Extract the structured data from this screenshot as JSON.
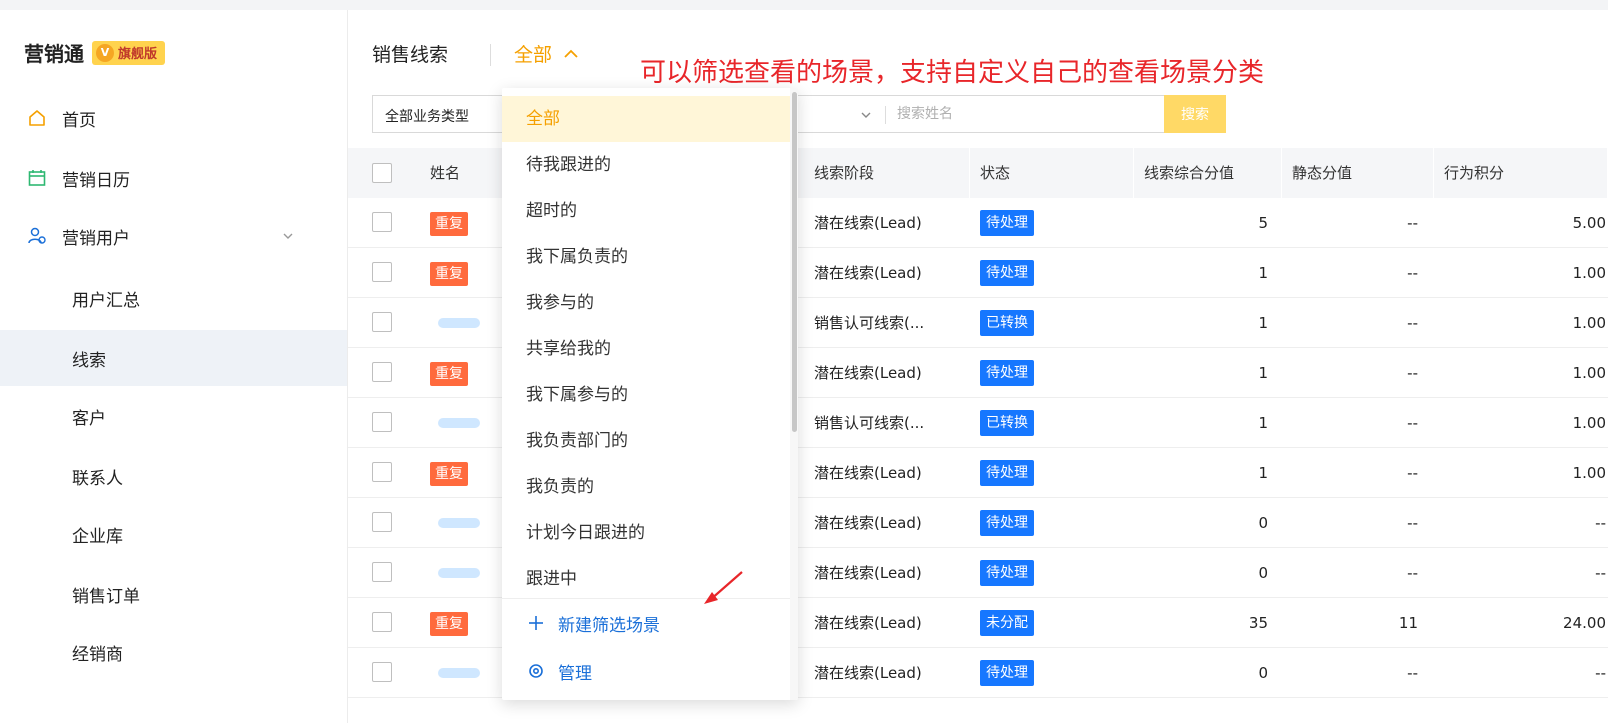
{
  "sidebar": {
    "brand": "营销通",
    "badge": "旗舰版",
    "badge_icon": "V",
    "items": [
      {
        "label": "首页",
        "icon": "home-icon"
      },
      {
        "label": "营销日历",
        "icon": "calendar-icon"
      },
      {
        "label": "营销用户",
        "icon": "user-group-icon"
      },
      {
        "label": "用户汇总"
      },
      {
        "label": "线索"
      },
      {
        "label": "客户"
      },
      {
        "label": "联系人"
      },
      {
        "label": "企业库"
      },
      {
        "label": "销售订单"
      },
      {
        "label": "经销商"
      }
    ]
  },
  "header": {
    "title": "销售线索",
    "scene": "全部"
  },
  "annotation": "可以筛选查看的场景，支持自定义自己的查看场景分类",
  "filters": {
    "type": "全部业务类型",
    "search_placeholder": "搜索姓名",
    "search_button": "搜索"
  },
  "dropdown": {
    "items": [
      "全部",
      "待我跟进的",
      "超时的",
      "我下属负责的",
      "我参与的",
      "共享给我的",
      "我下属参与的",
      "我负责部门的",
      "我负责的",
      "计划今日跟进的",
      "跟进中"
    ],
    "new_scene": "新建筛选场景",
    "manage": "管理"
  },
  "table": {
    "headers": {
      "name": "姓名",
      "stage": "线索阶段",
      "status": "状态",
      "score": "线索综合分值",
      "static": "静态分值",
      "behavior": "行为积分"
    },
    "dup_label": "重复",
    "rows": [
      {
        "dup": true,
        "stage": "潜在线索(Lead)",
        "status": "待处理",
        "score": "5",
        "static": "--",
        "behavior": "5.00"
      },
      {
        "dup": true,
        "stage": "潜在线索(Lead)",
        "status": "待处理",
        "score": "1",
        "static": "--",
        "behavior": "1.00"
      },
      {
        "dup": false,
        "stage": "销售认可线索(...",
        "status": "已转换",
        "score": "1",
        "static": "--",
        "behavior": "1.00"
      },
      {
        "dup": true,
        "stage": "潜在线索(Lead)",
        "status": "待处理",
        "score": "1",
        "static": "--",
        "behavior": "1.00"
      },
      {
        "dup": false,
        "stage": "销售认可线索(...",
        "status": "已转换",
        "score": "1",
        "static": "--",
        "behavior": "1.00"
      },
      {
        "dup": true,
        "stage": "潜在线索(Lead)",
        "status": "待处理",
        "score": "1",
        "static": "--",
        "behavior": "1.00"
      },
      {
        "dup": false,
        "stage": "潜在线索(Lead)",
        "status": "待处理",
        "score": "0",
        "static": "--",
        "behavior": "--"
      },
      {
        "dup": false,
        "stage": "潜在线索(Lead)",
        "status": "待处理",
        "score": "0",
        "static": "--",
        "behavior": "--"
      },
      {
        "dup": true,
        "stage": "潜在线索(Lead)",
        "status": "未分配",
        "score": "35",
        "static": "11",
        "behavior": "24.00"
      },
      {
        "dup": false,
        "stage": "潜在线索(Lead)",
        "status": "待处理",
        "score": "0",
        "static": "--",
        "behavior": "--"
      }
    ]
  },
  "colors": {
    "accent": "#f5a000",
    "status_pending": "#1677ff",
    "status_converted": "#1677ff",
    "status_unassigned": "#1677ff",
    "dup": "#ff6a3d",
    "annotation": "#e8262a"
  }
}
